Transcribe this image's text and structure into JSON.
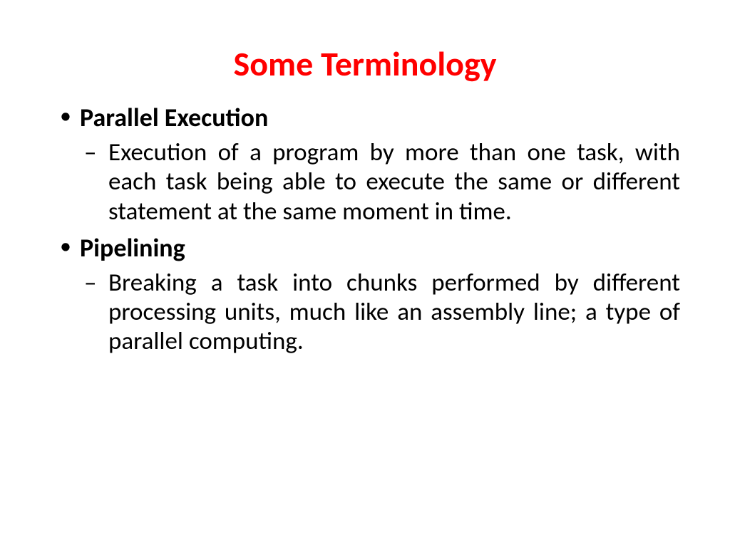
{
  "title": "Some Terminology",
  "terms": [
    {
      "name": "Parallel Execution",
      "definition": "Execution of a program by more than one task, with each task being able to execute the same or different statement at the same moment in time."
    },
    {
      "name": "Pipelining",
      "definition": "Breaking a task into chunks performed by different processing units, much like an assembly line; a type of parallel computing."
    }
  ]
}
